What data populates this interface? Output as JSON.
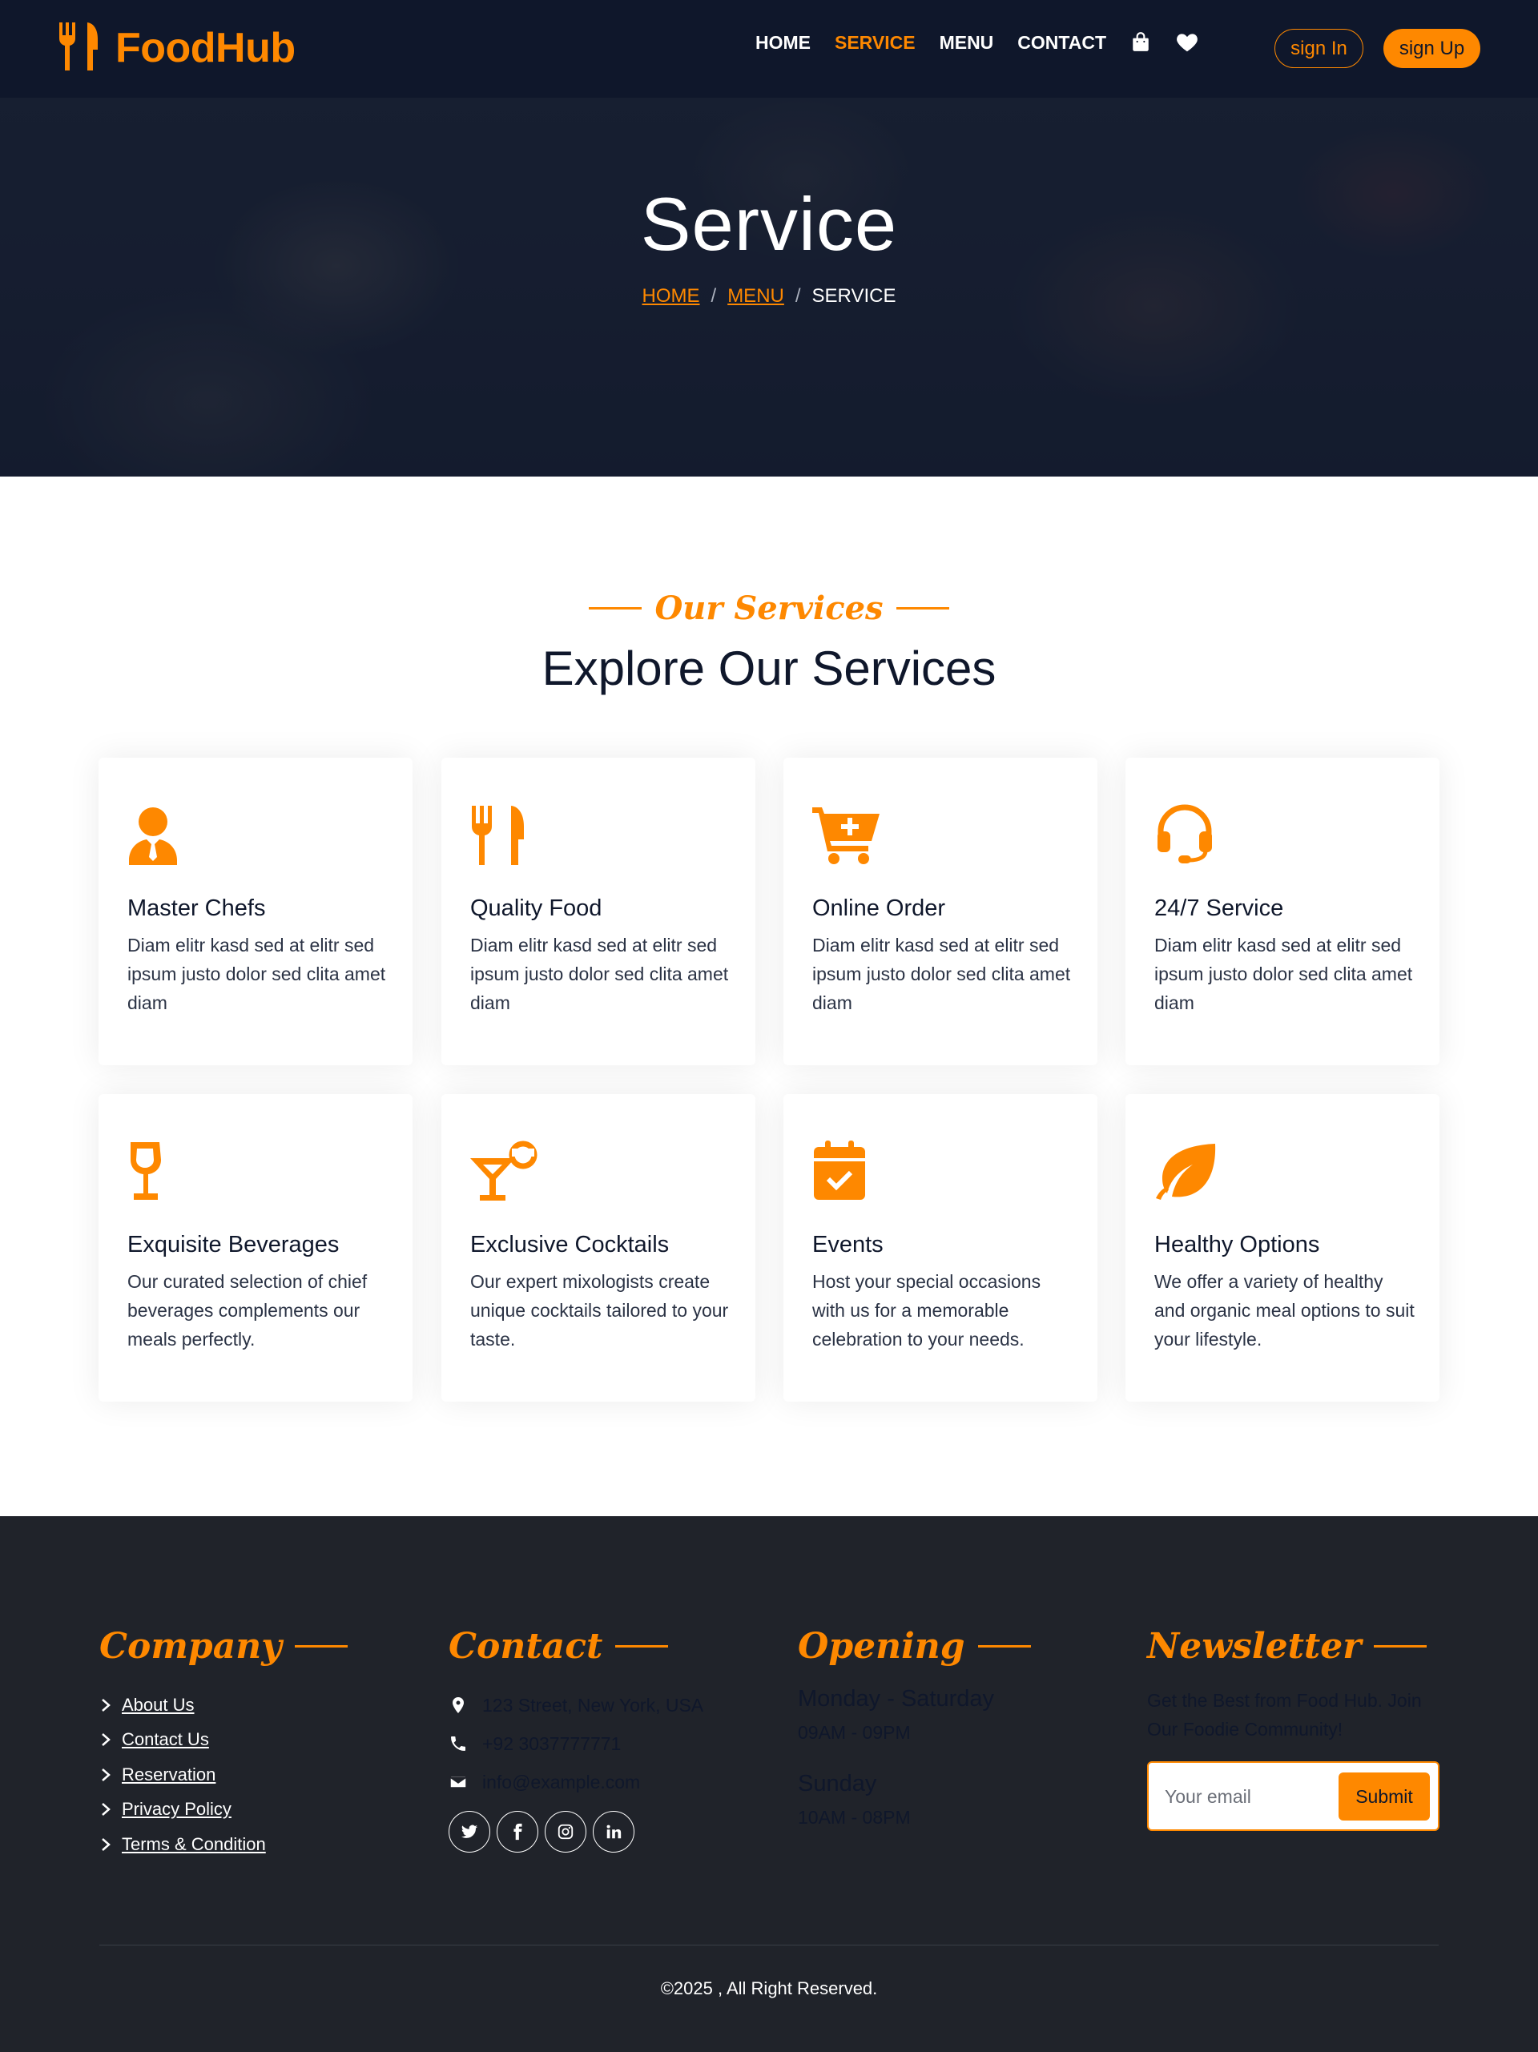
{
  "colors": {
    "accent": "#fe8800",
    "navy": "#0f172b",
    "footer_bg": "#20232a"
  },
  "brand": {
    "name": "FoodHub",
    "icon": "utensils-icon"
  },
  "nav": {
    "links": [
      "HOME",
      "SERVICE",
      "MENU",
      "CONTACT"
    ],
    "active": "SERVICE",
    "icons": [
      "shopping-bag-icon",
      "heart-icon"
    ],
    "signin_label": "sign In",
    "signup_label": "sign Up"
  },
  "hero": {
    "title": "Service",
    "breadcrumb": [
      {
        "label": "HOME",
        "link": true
      },
      {
        "label": "MENU",
        "link": true
      },
      {
        "label": "SERVICE",
        "link": false
      }
    ],
    "separator": "/"
  },
  "services": {
    "subtitle": "Our Services",
    "title": "Explore Our Services",
    "cards": [
      {
        "icon": "user-tie-icon",
        "title": "Master Chefs",
        "desc": "Diam elitr kasd sed at elitr sed ipsum justo dolor sed clita amet diam"
      },
      {
        "icon": "utensils-icon",
        "title": "Quality Food",
        "desc": "Diam elitr kasd sed at elitr sed ipsum justo dolor sed clita amet diam"
      },
      {
        "icon": "cart-plus-icon",
        "title": "Online Order",
        "desc": "Diam elitr kasd sed at elitr sed ipsum justo dolor sed clita amet diam"
      },
      {
        "icon": "headset-icon",
        "title": "24/7 Service",
        "desc": "Diam elitr kasd sed at elitr sed ipsum justo dolor sed clita amet diam"
      },
      {
        "icon": "wine-glass-icon",
        "title": "Exquisite Beverages",
        "desc": "Our curated selection of chief beverages complements our meals perfectly."
      },
      {
        "icon": "cocktail-icon",
        "title": "Exclusive Cocktails",
        "desc": "Our expert mixologists create unique cocktails tailored to your taste."
      },
      {
        "icon": "calendar-check-icon",
        "title": "Events",
        "desc": "Host your special occasions with us for a memorable celebration to your needs."
      },
      {
        "icon": "leaf-icon",
        "title": "Healthy Options",
        "desc": "We offer a variety of healthy and organic meal options to suit your lifestyle."
      }
    ]
  },
  "footer": {
    "company": {
      "heading": "Company",
      "links": [
        "About Us",
        "Contact Us",
        "Reservation",
        "Privacy Policy",
        "Terms & Condition"
      ]
    },
    "contact": {
      "heading": "Contact",
      "address": "123 Street, New York, USA",
      "phone": "+92 3037777771",
      "email": "info@example.com",
      "socials": [
        "twitter-icon",
        "facebook-icon",
        "instagram-icon",
        "linkedin-icon"
      ]
    },
    "opening": {
      "heading": "Opening",
      "day1": "Monday - Saturday",
      "time1": "09AM - 09PM",
      "day2": "Sunday",
      "time2": "10AM - 08PM"
    },
    "newsletter": {
      "heading": "Newsletter",
      "text": "Get the Best from Food Hub. Join Our Foodie Community!",
      "placeholder": "Your email",
      "submit_label": "Submit"
    },
    "copyright": "©2025 , All Right Reserved."
  }
}
